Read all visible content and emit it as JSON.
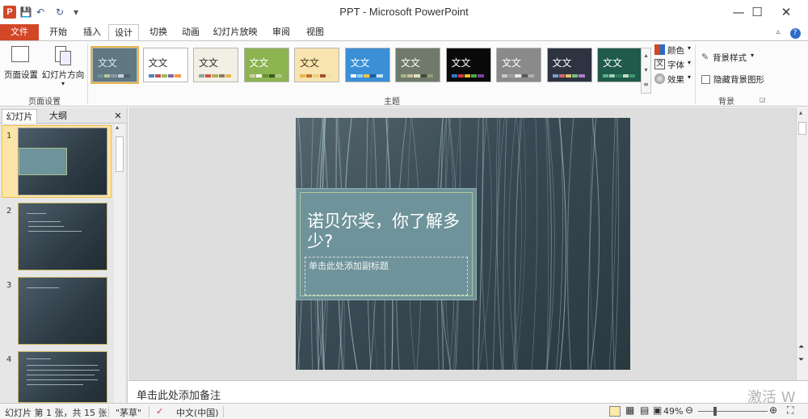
{
  "window": {
    "title": "PPT - Microsoft PowerPoint",
    "app_icon": "P",
    "min": "—",
    "max": "☐",
    "close": "✕"
  },
  "qat": {
    "save": "💾",
    "undo": "↶",
    "redo": "↻",
    "customize": "▾"
  },
  "tabs": [
    {
      "label": "文件"
    },
    {
      "label": "开始"
    },
    {
      "label": "插入"
    },
    {
      "label": "设计"
    },
    {
      "label": "切换"
    },
    {
      "label": "动画"
    },
    {
      "label": "幻灯片放映"
    },
    {
      "label": "审阅"
    },
    {
      "label": "视图"
    }
  ],
  "ribbon": {
    "page_setup": {
      "btn1": "页面设置",
      "btn2": "幻灯片方向",
      "group": "页面设置"
    },
    "themes": {
      "group": "主题",
      "sample": "文文",
      "count": 11
    },
    "theme_options": {
      "colors": "颜色",
      "fonts": "字体",
      "effects": "效果"
    },
    "background": {
      "styles": "背景样式",
      "hide": "隐藏背景图形",
      "group": "背景"
    }
  },
  "left_pane": {
    "tab_slides": "幻灯片",
    "tab_outline": "大纲",
    "close": "✕",
    "thumbs": [
      {
        "num": "1"
      },
      {
        "num": "2"
      },
      {
        "num": "3"
      },
      {
        "num": "4"
      }
    ]
  },
  "slide": {
    "title": "诺贝尔奖，你了解多少?",
    "subtitle_placeholder": "单击此处添加副标题"
  },
  "notes": {
    "placeholder": "单击此处添加备注"
  },
  "status": {
    "slide_info": "幻灯片 第 1 张，共 15 张",
    "theme_name": "\"茅草\"",
    "language": "中文(中国)",
    "zoom": "49%",
    "zoom_value": 49
  },
  "watermark": "激活 W",
  "colors": {
    "accent": "#d24726",
    "slide_bg": "#3a4a54",
    "title_box": "#6f939a"
  }
}
